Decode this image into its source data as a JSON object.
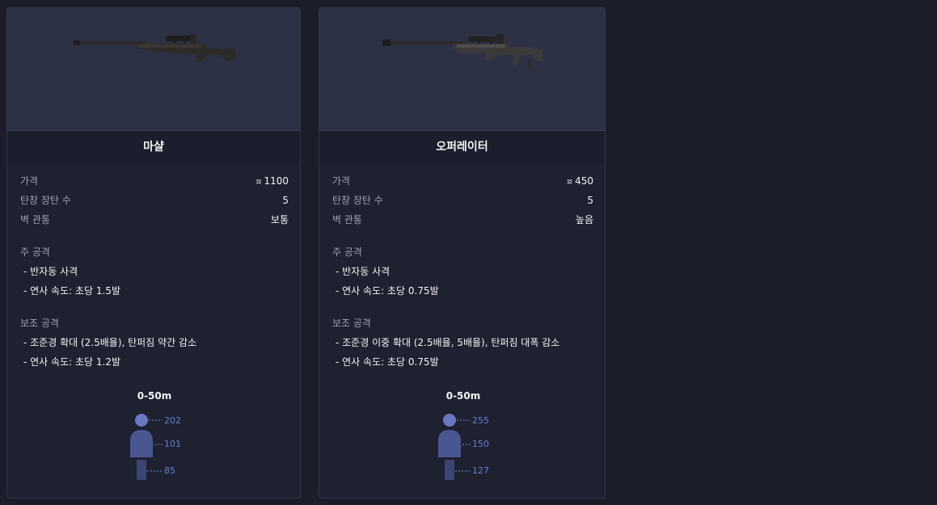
{
  "colors": {
    "page_bg": "#1b1d2a",
    "card_bg": "#1e2130",
    "image_bg": "#2d3145",
    "label": "#9ea1b1",
    "value": "#f2f3f7",
    "damage_head": "#6a76c2",
    "damage_body": "#4a5690",
    "damage_legs": "#3c4676",
    "damage_text": "#6b7ed0"
  },
  "cards": [
    {
      "name": "마샬",
      "image_icon": "sniper-rifle-icon",
      "stats": [
        {
          "label": "가격",
          "value": "1100",
          "credit_icon": "¤"
        },
        {
          "label": "탄창 장탄 수",
          "value": "5"
        },
        {
          "label": "벽 관통",
          "value": "보통"
        }
      ],
      "primary": {
        "title": "주 공격",
        "items": [
          "- 반자동 사격",
          "- 연사 속도: 초당 1.5발"
        ]
      },
      "secondary": {
        "title": "보조 공격",
        "items": [
          "- 조준경 확대 (2.5배율), 탄퍼짐 약간 감소",
          "- 연사 속도: 초당 1.2발"
        ]
      },
      "damage": {
        "range": "0-50m",
        "head": "202",
        "body": "101",
        "legs": "85"
      }
    },
    {
      "name": "오퍼레이터",
      "image_icon": "heavy-sniper-rifle-icon",
      "stats": [
        {
          "label": "가격",
          "value": "450",
          "credit_icon": "¤"
        },
        {
          "label": "탄창 장탄 수",
          "value": "5"
        },
        {
          "label": "벽 관통",
          "value": "높음"
        }
      ],
      "primary": {
        "title": "주 공격",
        "items": [
          "- 반자동 사격",
          "- 연사 속도: 초당 0.75발"
        ]
      },
      "secondary": {
        "title": "보조 공격",
        "items": [
          "- 조준경 이중 확대 (2.5배율, 5배율), 탄퍼짐 대폭 감소",
          "- 연사 속도: 초당 0.75발"
        ]
      },
      "damage": {
        "range": "0-50m",
        "head": "255",
        "body": "150",
        "legs": "127"
      }
    }
  ]
}
